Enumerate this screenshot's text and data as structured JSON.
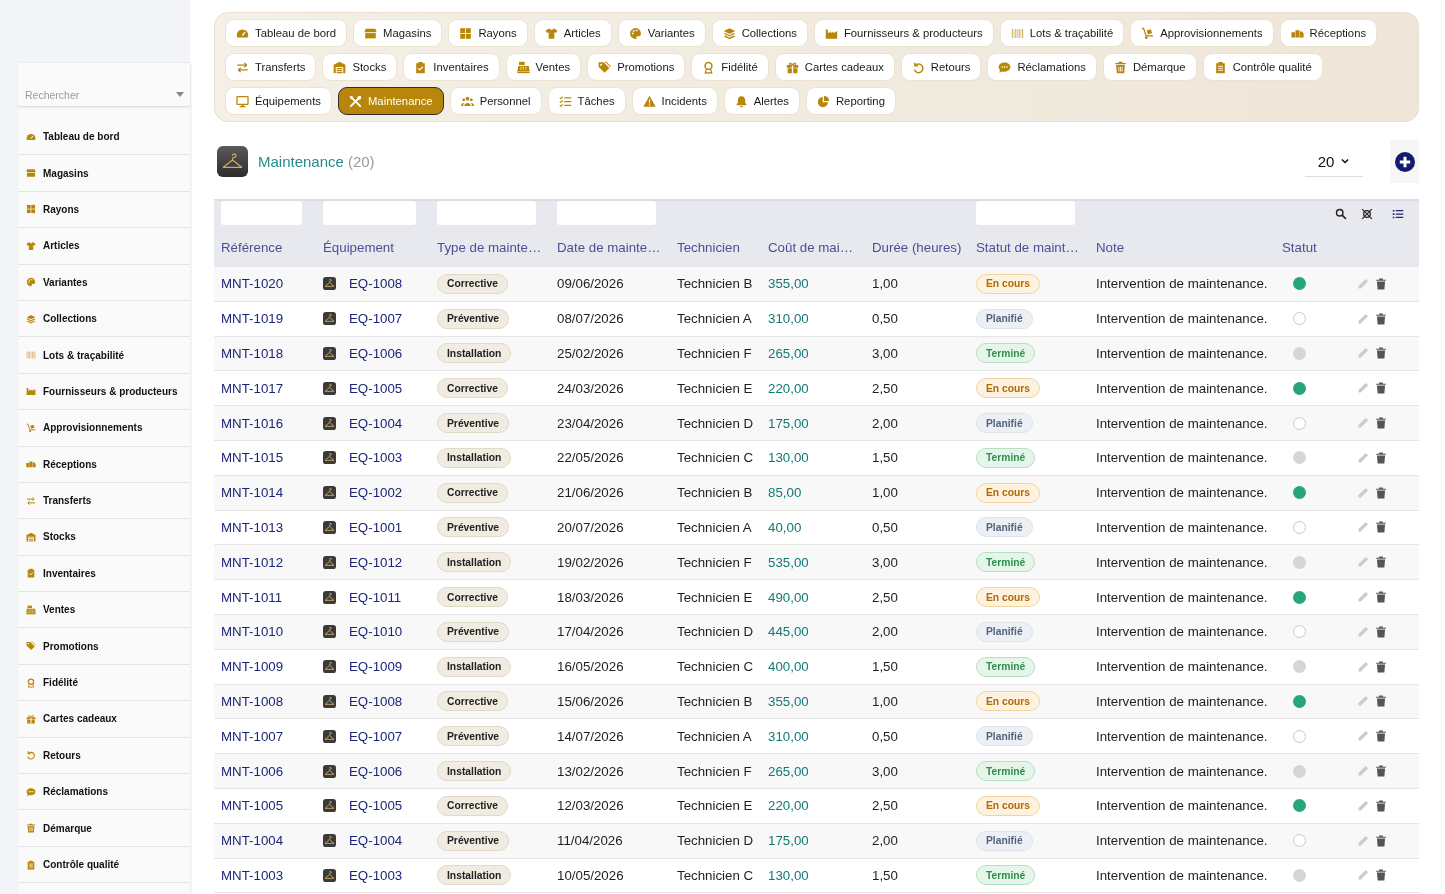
{
  "sidebar": {
    "search": {
      "placeholder": "Rechercher"
    },
    "items": [
      {
        "label": "Tableau de bord",
        "selected": false
      },
      {
        "label": "Magasins",
        "selected": false
      },
      {
        "label": "Rayons",
        "selected": false
      },
      {
        "label": "Articles",
        "selected": false
      },
      {
        "label": "Variantes",
        "selected": false
      },
      {
        "label": "Collections",
        "selected": false
      },
      {
        "label": "Lots & traçabilité",
        "selected": false
      },
      {
        "label": "Fournisseurs & producteurs",
        "selected": false
      },
      {
        "label": "Approvisionnements",
        "selected": false
      },
      {
        "label": "Réceptions",
        "selected": false
      },
      {
        "label": "Transferts",
        "selected": false
      },
      {
        "label": "Stocks",
        "selected": false
      },
      {
        "label": "Inventaires",
        "selected": false
      },
      {
        "label": "Ventes",
        "selected": false
      },
      {
        "label": "Promotions",
        "selected": false
      },
      {
        "label": "Fidélité",
        "selected": false
      },
      {
        "label": "Cartes cadeaux",
        "selected": false
      },
      {
        "label": "Retours",
        "selected": false
      },
      {
        "label": "Réclamations",
        "selected": false
      },
      {
        "label": "Démarque",
        "selected": false
      },
      {
        "label": "Contrôle qualité",
        "selected": false
      }
    ]
  },
  "nav": {
    "tabs": [
      {
        "label": "Tableau de bord",
        "selected": false
      },
      {
        "label": "Magasins",
        "selected": false
      },
      {
        "label": "Rayons",
        "selected": false
      },
      {
        "label": "Articles",
        "selected": false
      },
      {
        "label": "Variantes",
        "selected": false
      },
      {
        "label": "Collections",
        "selected": false
      },
      {
        "label": "Fournisseurs & producteurs",
        "selected": false
      },
      {
        "label": "Lots & traçabilité",
        "selected": false
      },
      {
        "label": "Approvisionnements",
        "selected": false
      },
      {
        "label": "Réceptions",
        "selected": false
      },
      {
        "label": "Transferts",
        "selected": false
      },
      {
        "label": "Stocks",
        "selected": false
      },
      {
        "label": "Inventaires",
        "selected": false
      },
      {
        "label": "Ventes",
        "selected": false
      },
      {
        "label": "Promotions",
        "selected": false
      },
      {
        "label": "Fidélité",
        "selected": false
      },
      {
        "label": "Cartes cadeaux",
        "selected": false
      },
      {
        "label": "Retours",
        "selected": false
      },
      {
        "label": "Réclamations",
        "selected": false
      },
      {
        "label": "Démarque",
        "selected": false
      },
      {
        "label": "Contrôle qualité",
        "selected": false
      },
      {
        "label": "Équipements",
        "selected": false
      },
      {
        "label": "Maintenance",
        "selected": true
      },
      {
        "label": "Personnel",
        "selected": false
      },
      {
        "label": "Tâches",
        "selected": false
      },
      {
        "label": "Incidents",
        "selected": false
      },
      {
        "label": "Alertes",
        "selected": false
      },
      {
        "label": "Reporting",
        "selected": false
      }
    ]
  },
  "header": {
    "title": "Maintenance",
    "count": "(20)",
    "page_size": "20"
  },
  "table": {
    "columns": [
      {
        "label": "Référence",
        "filter": true
      },
      {
        "label": "Équipement",
        "filter": true
      },
      {
        "label": "Type de mainte…",
        "filter": true
      },
      {
        "label": "Date de mainte…",
        "filter": true
      },
      {
        "label": "Technicien",
        "filter": false
      },
      {
        "label": "Coût de mai…",
        "filter": false
      },
      {
        "label": "Durée (heures)",
        "filter": false
      },
      {
        "label": "Statut de maint…",
        "filter": true
      },
      {
        "label": "Note",
        "filter": false
      },
      {
        "label": "Statut",
        "filter": false
      }
    ],
    "rows": [
      {
        "reference": "MNT-1020",
        "equipment": "EQ-1008",
        "type": "Corrective",
        "date": "09/06/2026",
        "technician": "Technicien B",
        "cost": "355,00",
        "duration": "1,00",
        "status": {
          "label": "En cours",
          "kind": "in_progress"
        },
        "note": "Intervention de maintenance.",
        "status_dot": {
          "filled": true,
          "color": "#27a67b"
        }
      },
      {
        "reference": "MNT-1019",
        "equipment": "EQ-1007",
        "type": "Préventive",
        "date": "08/07/2026",
        "technician": "Technicien A",
        "cost": "310,00",
        "duration": "0,50",
        "status": {
          "label": "Planifié",
          "kind": "planned"
        },
        "note": "Intervention de maintenance.",
        "status_dot": {
          "filled": false,
          "color": "#c9c9c9"
        }
      },
      {
        "reference": "MNT-1018",
        "equipment": "EQ-1006",
        "type": "Installation",
        "date": "25/02/2026",
        "technician": "Technicien F",
        "cost": "265,00",
        "duration": "3,00",
        "status": {
          "label": "Terminé",
          "kind": "done"
        },
        "note": "Intervention de maintenance.",
        "status_dot": {
          "filled": true,
          "color": "#d6d6d6"
        }
      },
      {
        "reference": "MNT-1017",
        "equipment": "EQ-1005",
        "type": "Corrective",
        "date": "24/03/2026",
        "technician": "Technicien E",
        "cost": "220,00",
        "duration": "2,50",
        "status": {
          "label": "En cours",
          "kind": "in_progress"
        },
        "note": "Intervention de maintenance.",
        "status_dot": {
          "filled": true,
          "color": "#27a67b"
        }
      },
      {
        "reference": "MNT-1016",
        "equipment": "EQ-1004",
        "type": "Préventive",
        "date": "23/04/2026",
        "technician": "Technicien D",
        "cost": "175,00",
        "duration": "2,00",
        "status": {
          "label": "Planifié",
          "kind": "planned"
        },
        "note": "Intervention de maintenance.",
        "status_dot": {
          "filled": false,
          "color": "#c9c9c9"
        }
      },
      {
        "reference": "MNT-1015",
        "equipment": "EQ-1003",
        "type": "Installation",
        "date": "22/05/2026",
        "technician": "Technicien C",
        "cost": "130,00",
        "duration": "1,50",
        "status": {
          "label": "Terminé",
          "kind": "done"
        },
        "note": "Intervention de maintenance.",
        "status_dot": {
          "filled": true,
          "color": "#d6d6d6"
        }
      },
      {
        "reference": "MNT-1014",
        "equipment": "EQ-1002",
        "type": "Corrective",
        "date": "21/06/2026",
        "technician": "Technicien B",
        "cost": "85,00",
        "duration": "1,00",
        "status": {
          "label": "En cours",
          "kind": "in_progress"
        },
        "note": "Intervention de maintenance.",
        "status_dot": {
          "filled": true,
          "color": "#27a67b"
        }
      },
      {
        "reference": "MNT-1013",
        "equipment": "EQ-1001",
        "type": "Préventive",
        "date": "20/07/2026",
        "technician": "Technicien A",
        "cost": "40,00",
        "duration": "0,50",
        "status": {
          "label": "Planifié",
          "kind": "planned"
        },
        "note": "Intervention de maintenance.",
        "status_dot": {
          "filled": false,
          "color": "#c9c9c9"
        }
      },
      {
        "reference": "MNT-1012",
        "equipment": "EQ-1012",
        "type": "Installation",
        "date": "19/02/2026",
        "technician": "Technicien F",
        "cost": "535,00",
        "duration": "3,00",
        "status": {
          "label": "Terminé",
          "kind": "done"
        },
        "note": "Intervention de maintenance.",
        "status_dot": {
          "filled": true,
          "color": "#d6d6d6"
        }
      },
      {
        "reference": "MNT-1011",
        "equipment": "EQ-1011",
        "type": "Corrective",
        "date": "18/03/2026",
        "technician": "Technicien E",
        "cost": "490,00",
        "duration": "2,50",
        "status": {
          "label": "En cours",
          "kind": "in_progress"
        },
        "note": "Intervention de maintenance.",
        "status_dot": {
          "filled": true,
          "color": "#27a67b"
        }
      },
      {
        "reference": "MNT-1010",
        "equipment": "EQ-1010",
        "type": "Préventive",
        "date": "17/04/2026",
        "technician": "Technicien D",
        "cost": "445,00",
        "duration": "2,00",
        "status": {
          "label": "Planifié",
          "kind": "planned"
        },
        "note": "Intervention de maintenance.",
        "status_dot": {
          "filled": false,
          "color": "#c9c9c9"
        }
      },
      {
        "reference": "MNT-1009",
        "equipment": "EQ-1009",
        "type": "Installation",
        "date": "16/05/2026",
        "technician": "Technicien C",
        "cost": "400,00",
        "duration": "1,50",
        "status": {
          "label": "Terminé",
          "kind": "done"
        },
        "note": "Intervention de maintenance.",
        "status_dot": {
          "filled": true,
          "color": "#d6d6d6"
        }
      },
      {
        "reference": "MNT-1008",
        "equipment": "EQ-1008",
        "type": "Corrective",
        "date": "15/06/2026",
        "technician": "Technicien B",
        "cost": "355,00",
        "duration": "1,00",
        "status": {
          "label": "En cours",
          "kind": "in_progress"
        },
        "note": "Intervention de maintenance.",
        "status_dot": {
          "filled": true,
          "color": "#27a67b"
        }
      },
      {
        "reference": "MNT-1007",
        "equipment": "EQ-1007",
        "type": "Préventive",
        "date": "14/07/2026",
        "technician": "Technicien A",
        "cost": "310,00",
        "duration": "0,50",
        "status": {
          "label": "Planifié",
          "kind": "planned"
        },
        "note": "Intervention de maintenance.",
        "status_dot": {
          "filled": false,
          "color": "#c9c9c9"
        }
      },
      {
        "reference": "MNT-1006",
        "equipment": "EQ-1006",
        "type": "Installation",
        "date": "13/02/2026",
        "technician": "Technicien F",
        "cost": "265,00",
        "duration": "3,00",
        "status": {
          "label": "Terminé",
          "kind": "done"
        },
        "note": "Intervention de maintenance.",
        "status_dot": {
          "filled": true,
          "color": "#d6d6d6"
        }
      },
      {
        "reference": "MNT-1005",
        "equipment": "EQ-1005",
        "type": "Corrective",
        "date": "12/03/2026",
        "technician": "Technicien E",
        "cost": "220,00",
        "duration": "2,50",
        "status": {
          "label": "En cours",
          "kind": "in_progress"
        },
        "note": "Intervention de maintenance.",
        "status_dot": {
          "filled": true,
          "color": "#27a67b"
        }
      },
      {
        "reference": "MNT-1004",
        "equipment": "EQ-1004",
        "type": "Préventive",
        "date": "11/04/2026",
        "technician": "Technicien D",
        "cost": "175,00",
        "duration": "2,00",
        "status": {
          "label": "Planifié",
          "kind": "planned"
        },
        "note": "Intervention de maintenance.",
        "status_dot": {
          "filled": false,
          "color": "#c9c9c9"
        }
      },
      {
        "reference": "MNT-1003",
        "equipment": "EQ-1003",
        "type": "Installation",
        "date": "10/05/2026",
        "technician": "Technicien C",
        "cost": "130,00",
        "duration": "1,50",
        "status": {
          "label": "Terminé",
          "kind": "done"
        },
        "note": "Intervention de maintenance.",
        "status_dot": {
          "filled": true,
          "color": "#d6d6d6"
        }
      }
    ]
  }
}
